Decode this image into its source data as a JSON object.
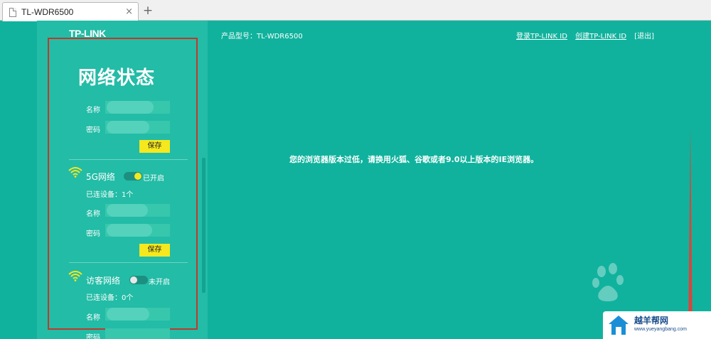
{
  "browser": {
    "tab_title": "TL-WDR6500",
    "tab_close": "×",
    "new_tab": "+"
  },
  "brand": {
    "logo": "TP-LINK",
    "accent_bg": "#10b29d",
    "sidebar_bg": "#23bca6",
    "button_color": "#f5e81e"
  },
  "header": {
    "model": "产品型号：TL-WDR6500",
    "login_link": "登录TP-LINK ID",
    "create_link": "创建TP-LINK ID",
    "logout": "[退出]"
  },
  "panel": {
    "title": "网络状态",
    "wifi24": {
      "name_label": "名称",
      "password_label": "密码",
      "save": "保存"
    },
    "wifi5g": {
      "title": "5G网络",
      "toggle_state": "已开启",
      "connected": "已连设备：1个",
      "name_label": "名称",
      "password_label": "密码",
      "save": "保存"
    },
    "guest": {
      "title": "访客网络",
      "toggle_state": "未开启",
      "connected": "已连设备：0个",
      "name_label": "名称",
      "password_label": "密码"
    }
  },
  "main": {
    "browser_warning": "您的浏览器版本过低，请换用火狐、谷歌或者9.0以上版本的IE浏览器。"
  },
  "watermarks": {
    "site_title": "越羊帮网",
    "site_url": "www.yueyangbang.com"
  },
  "icons": [
    "file-icon",
    "close-icon",
    "plus-icon",
    "wifi-icon"
  ]
}
